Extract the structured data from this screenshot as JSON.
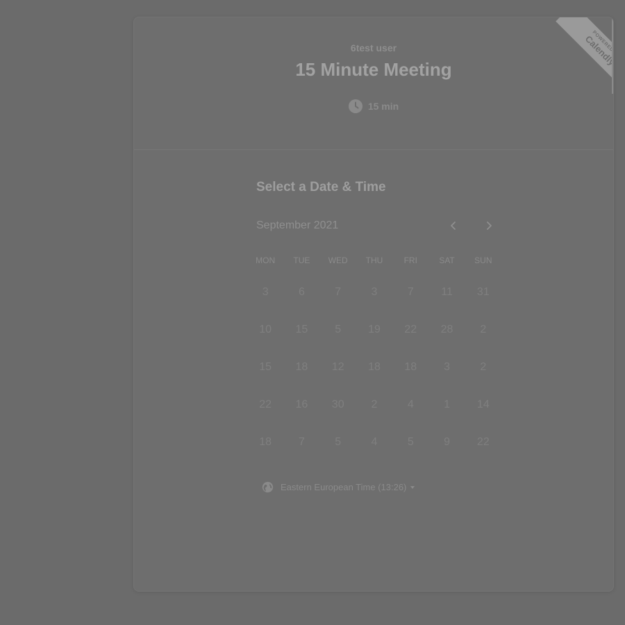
{
  "header": {
    "owner_name": "6test user",
    "event_title": "15 Minute Meeting",
    "duration": "15 min",
    "duration_icon": "clock-icon"
  },
  "ribbon": {
    "small_text": "POWERED BY",
    "brand": "Calendly"
  },
  "scheduler": {
    "title": "Select a Date & Time",
    "month": "September 2021",
    "prev_icon": "chevron-left-icon",
    "next_icon": "chevron-right-icon",
    "weekdays": [
      "MON",
      "TUE",
      "WED",
      "THU",
      "FRI",
      "SAT",
      "SUN"
    ],
    "weeks": [
      [
        "3",
        "6",
        "7",
        "3",
        "7",
        "11",
        "31"
      ],
      [
        "10",
        "15",
        "5",
        "19",
        "22",
        "28",
        "2"
      ],
      [
        "15",
        "18",
        "12",
        "18",
        "18",
        "3",
        "2"
      ],
      [
        "22",
        "16",
        "30",
        "2",
        "4",
        "1",
        "14"
      ],
      [
        "18",
        "7",
        "5",
        "4",
        "5",
        "9",
        "22"
      ]
    ]
  },
  "timezone": {
    "label": "Eastern European Time (13:26)",
    "icon": "globe-icon"
  },
  "colors": {
    "overlay_background": "#6b6b6b",
    "card_background": "#6e6e6e",
    "ribbon": "#9a9a9a"
  }
}
